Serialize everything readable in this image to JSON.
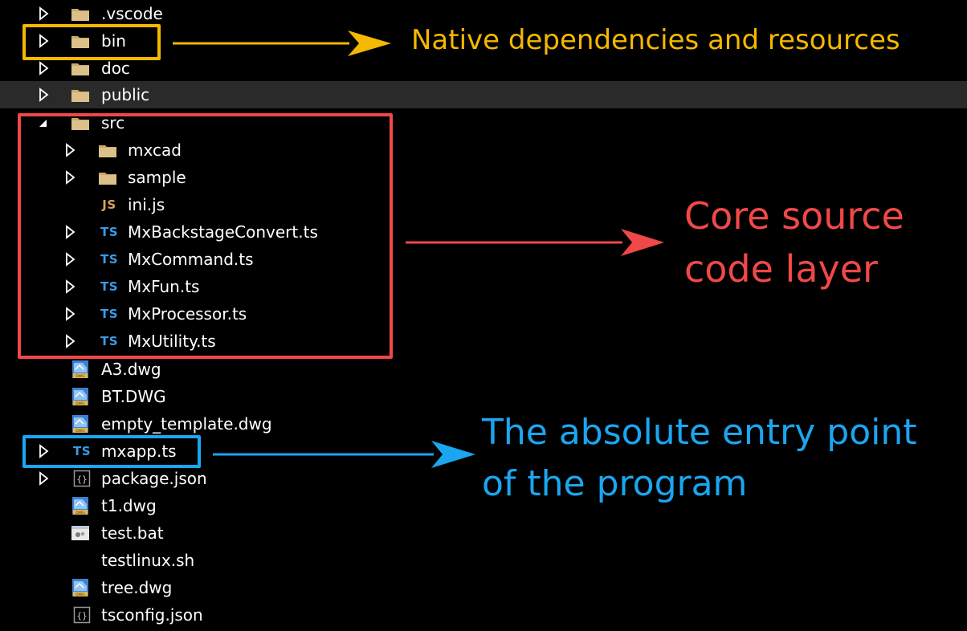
{
  "tree": {
    "items": [
      {
        "label": ".vscode",
        "type": "folder",
        "expander": "collapsed"
      },
      {
        "label": "bin",
        "type": "folder",
        "expander": "collapsed"
      },
      {
        "label": "doc",
        "type": "folder",
        "expander": "collapsed"
      },
      {
        "label": "public",
        "type": "folder",
        "expander": "collapsed",
        "hovered": true
      },
      {
        "label": "src",
        "type": "folder",
        "expander": "expanded"
      },
      {
        "label": "mxcad",
        "type": "folder",
        "expander": "collapsed"
      },
      {
        "label": "sample",
        "type": "folder",
        "expander": "collapsed"
      },
      {
        "label": "ini.js",
        "type": "js-file",
        "badge": "JS"
      },
      {
        "label": "MxBackstageConvert.ts",
        "type": "ts-file",
        "badge": "TS",
        "expander": "collapsed"
      },
      {
        "label": "MxCommand.ts",
        "type": "ts-file",
        "badge": "TS",
        "expander": "collapsed"
      },
      {
        "label": "MxFun.ts",
        "type": "ts-file",
        "badge": "TS",
        "expander": "collapsed"
      },
      {
        "label": "MxProcessor.ts",
        "type": "ts-file",
        "badge": "TS",
        "expander": "collapsed"
      },
      {
        "label": "MxUtility.ts",
        "type": "ts-file",
        "badge": "TS",
        "expander": "collapsed"
      },
      {
        "label": "A3.dwg",
        "type": "dwg-file"
      },
      {
        "label": "BT.DWG",
        "type": "dwg-file"
      },
      {
        "label": "empty_template.dwg",
        "type": "dwg-file"
      },
      {
        "label": "mxapp.ts",
        "type": "ts-file",
        "badge": "TS",
        "expander": "collapsed"
      },
      {
        "label": "package.json",
        "type": "json-file",
        "expander": "collapsed"
      },
      {
        "label": "t1.dwg",
        "type": "dwg-file"
      },
      {
        "label": "test.bat",
        "type": "bat-file"
      },
      {
        "label": "testlinux.sh",
        "type": "sh-file"
      },
      {
        "label": "tree.dwg",
        "type": "dwg-file"
      },
      {
        "label": "tsconfig.json",
        "type": "json-file"
      }
    ]
  },
  "annotations": {
    "bin_note": "Native dependencies and resources",
    "src_note_line1": "Core source",
    "src_note_line2": "code layer",
    "entry_note_line1": "The absolute entry point",
    "entry_note_line2": "of the program"
  },
  "colors": {
    "bin_highlight": "#f5b800",
    "src_highlight": "#f04848",
    "entry_highlight": "#1aa6f0",
    "folder_icon": "#c9a86a",
    "ts_badge": "#3b9be8",
    "js_badge": "#d9a35b",
    "hover_row": "#2a2a2a"
  }
}
